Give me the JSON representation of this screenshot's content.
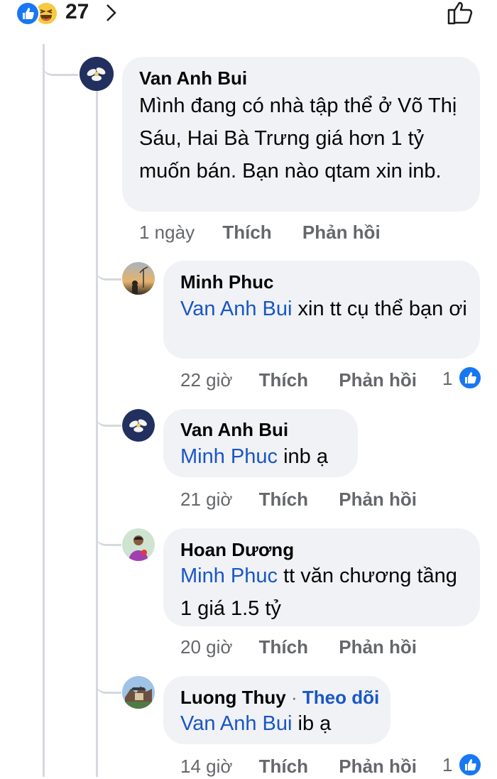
{
  "reactions": {
    "count": "27",
    "types": [
      "like-icon",
      "haha-icon"
    ]
  },
  "comments": [
    {
      "author": "Van Anh Bui",
      "text": "Mình đang có nhà tập thể ở Võ Thị Sáu, Hai Bà Trưng giá hơn 1 tỷ muốn bán. Bạn nào qtam xin inb.",
      "time": "1 ngày",
      "like": "Thích",
      "reply": "Phản hồi"
    }
  ],
  "replies": [
    {
      "author": "Minh Phuc",
      "mention": "Van Anh Bui",
      "text": " xin tt cụ thể bạn ơi",
      "time": "22 giờ",
      "like": "Thích",
      "reply": "Phản hồi",
      "like_count": "1"
    },
    {
      "author": "Van Anh Bui",
      "mention": "Minh Phuc",
      "text": " inb ạ",
      "time": "21 giờ",
      "like": "Thích",
      "reply": "Phản hồi"
    },
    {
      "author": "Hoan Dương",
      "mention": "Minh Phuc",
      "text": " tt văn chương tầng 1 giá 1.5 tỷ",
      "time": "20 giờ",
      "like": "Thích",
      "reply": "Phản hồi"
    },
    {
      "author": "Luong Thuy",
      "follow": "Theo dõi",
      "separator": "·",
      "mention": "Van Anh Bui",
      "text": " ib ạ",
      "time": "14 giờ",
      "like": "Thích",
      "reply": "Phản hồi",
      "like_count": "1"
    }
  ],
  "colors": {
    "accent": "#1877f2",
    "mention": "#1a56c6",
    "bubble": "#f0f2f5",
    "meta": "#65676b"
  }
}
